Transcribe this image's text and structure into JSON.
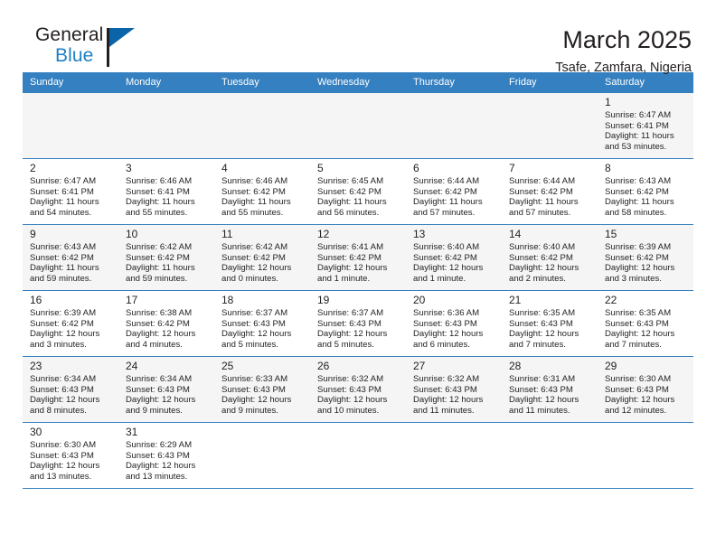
{
  "brand": {
    "name_part1": "General",
    "name_part2": "Blue",
    "flag_color": "#0b63a8",
    "blue_color": "#1f7fc4"
  },
  "header": {
    "title": "March 2025",
    "location": "Tsafe, Zamfara, Nigeria"
  },
  "theme": {
    "header_bg": "#3580c0",
    "row_shade": "#f5f5f5",
    "text": "#231f20"
  },
  "weekdays": [
    "Sunday",
    "Monday",
    "Tuesday",
    "Wednesday",
    "Thursday",
    "Friday",
    "Saturday"
  ],
  "weeks": [
    [
      {
        "day": "",
        "info": ""
      },
      {
        "day": "",
        "info": ""
      },
      {
        "day": "",
        "info": ""
      },
      {
        "day": "",
        "info": ""
      },
      {
        "day": "",
        "info": ""
      },
      {
        "day": "",
        "info": ""
      },
      {
        "day": "1",
        "info": "Sunrise: 6:47 AM\nSunset: 6:41 PM\nDaylight: 11 hours\nand 53 minutes."
      }
    ],
    [
      {
        "day": "2",
        "info": "Sunrise: 6:47 AM\nSunset: 6:41 PM\nDaylight: 11 hours\nand 54 minutes."
      },
      {
        "day": "3",
        "info": "Sunrise: 6:46 AM\nSunset: 6:41 PM\nDaylight: 11 hours\nand 55 minutes."
      },
      {
        "day": "4",
        "info": "Sunrise: 6:46 AM\nSunset: 6:42 PM\nDaylight: 11 hours\nand 55 minutes."
      },
      {
        "day": "5",
        "info": "Sunrise: 6:45 AM\nSunset: 6:42 PM\nDaylight: 11 hours\nand 56 minutes."
      },
      {
        "day": "6",
        "info": "Sunrise: 6:44 AM\nSunset: 6:42 PM\nDaylight: 11 hours\nand 57 minutes."
      },
      {
        "day": "7",
        "info": "Sunrise: 6:44 AM\nSunset: 6:42 PM\nDaylight: 11 hours\nand 57 minutes."
      },
      {
        "day": "8",
        "info": "Sunrise: 6:43 AM\nSunset: 6:42 PM\nDaylight: 11 hours\nand 58 minutes."
      }
    ],
    [
      {
        "day": "9",
        "info": "Sunrise: 6:43 AM\nSunset: 6:42 PM\nDaylight: 11 hours\nand 59 minutes."
      },
      {
        "day": "10",
        "info": "Sunrise: 6:42 AM\nSunset: 6:42 PM\nDaylight: 11 hours\nand 59 minutes."
      },
      {
        "day": "11",
        "info": "Sunrise: 6:42 AM\nSunset: 6:42 PM\nDaylight: 12 hours\nand 0 minutes."
      },
      {
        "day": "12",
        "info": "Sunrise: 6:41 AM\nSunset: 6:42 PM\nDaylight: 12 hours\nand 1 minute."
      },
      {
        "day": "13",
        "info": "Sunrise: 6:40 AM\nSunset: 6:42 PM\nDaylight: 12 hours\nand 1 minute."
      },
      {
        "day": "14",
        "info": "Sunrise: 6:40 AM\nSunset: 6:42 PM\nDaylight: 12 hours\nand 2 minutes."
      },
      {
        "day": "15",
        "info": "Sunrise: 6:39 AM\nSunset: 6:42 PM\nDaylight: 12 hours\nand 3 minutes."
      }
    ],
    [
      {
        "day": "16",
        "info": "Sunrise: 6:39 AM\nSunset: 6:42 PM\nDaylight: 12 hours\nand 3 minutes."
      },
      {
        "day": "17",
        "info": "Sunrise: 6:38 AM\nSunset: 6:42 PM\nDaylight: 12 hours\nand 4 minutes."
      },
      {
        "day": "18",
        "info": "Sunrise: 6:37 AM\nSunset: 6:43 PM\nDaylight: 12 hours\nand 5 minutes."
      },
      {
        "day": "19",
        "info": "Sunrise: 6:37 AM\nSunset: 6:43 PM\nDaylight: 12 hours\nand 5 minutes."
      },
      {
        "day": "20",
        "info": "Sunrise: 6:36 AM\nSunset: 6:43 PM\nDaylight: 12 hours\nand 6 minutes."
      },
      {
        "day": "21",
        "info": "Sunrise: 6:35 AM\nSunset: 6:43 PM\nDaylight: 12 hours\nand 7 minutes."
      },
      {
        "day": "22",
        "info": "Sunrise: 6:35 AM\nSunset: 6:43 PM\nDaylight: 12 hours\nand 7 minutes."
      }
    ],
    [
      {
        "day": "23",
        "info": "Sunrise: 6:34 AM\nSunset: 6:43 PM\nDaylight: 12 hours\nand 8 minutes."
      },
      {
        "day": "24",
        "info": "Sunrise: 6:34 AM\nSunset: 6:43 PM\nDaylight: 12 hours\nand 9 minutes."
      },
      {
        "day": "25",
        "info": "Sunrise: 6:33 AM\nSunset: 6:43 PM\nDaylight: 12 hours\nand 9 minutes."
      },
      {
        "day": "26",
        "info": "Sunrise: 6:32 AM\nSunset: 6:43 PM\nDaylight: 12 hours\nand 10 minutes."
      },
      {
        "day": "27",
        "info": "Sunrise: 6:32 AM\nSunset: 6:43 PM\nDaylight: 12 hours\nand 11 minutes."
      },
      {
        "day": "28",
        "info": "Sunrise: 6:31 AM\nSunset: 6:43 PM\nDaylight: 12 hours\nand 11 minutes."
      },
      {
        "day": "29",
        "info": "Sunrise: 6:30 AM\nSunset: 6:43 PM\nDaylight: 12 hours\nand 12 minutes."
      }
    ],
    [
      {
        "day": "30",
        "info": "Sunrise: 6:30 AM\nSunset: 6:43 PM\nDaylight: 12 hours\nand 13 minutes."
      },
      {
        "day": "31",
        "info": "Sunrise: 6:29 AM\nSunset: 6:43 PM\nDaylight: 12 hours\nand 13 minutes."
      },
      {
        "day": "",
        "info": ""
      },
      {
        "day": "",
        "info": ""
      },
      {
        "day": "",
        "info": ""
      },
      {
        "day": "",
        "info": ""
      },
      {
        "day": "",
        "info": ""
      }
    ]
  ]
}
